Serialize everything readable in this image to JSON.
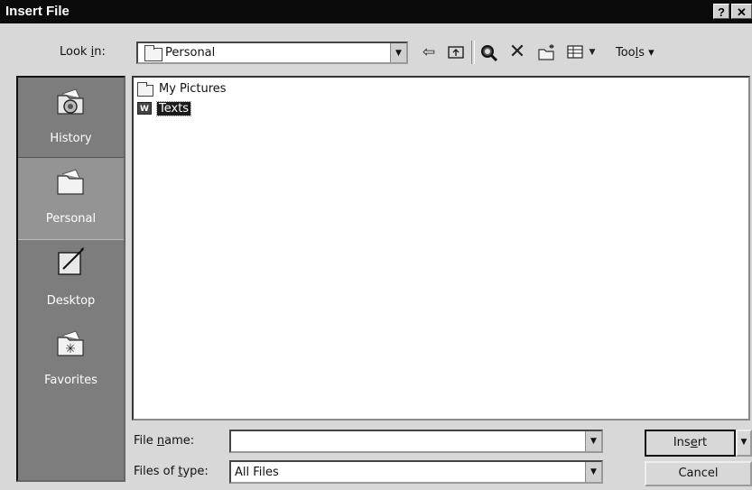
{
  "window": {
    "title": "Insert File",
    "help_label": "?",
    "close_label": "✕"
  },
  "lookin": {
    "label": "Look in:",
    "value": "Personal"
  },
  "toolbar": {
    "tools_label": "Tools ▾",
    "icons": [
      "back-icon",
      "up-folder-icon",
      "search-web-icon",
      "delete-icon",
      "new-folder-icon",
      "views-icon"
    ]
  },
  "places": [
    {
      "label": "History",
      "icon": "history-icon",
      "selected": false
    },
    {
      "label": "Personal",
      "icon": "personal-folder-icon",
      "selected": true
    },
    {
      "label": "Desktop",
      "icon": "desktop-icon",
      "selected": false
    },
    {
      "label": "Favorites",
      "icon": "favorites-icon",
      "selected": false
    }
  ],
  "files": [
    {
      "name": "My Pictures",
      "type": "folder",
      "selected": false
    },
    {
      "name": "Texts",
      "type": "word-document",
      "selected": true
    }
  ],
  "filename": {
    "label": "File name:",
    "value": ""
  },
  "filetype": {
    "label": "Files of type:",
    "value": "All Files"
  },
  "buttons": {
    "insert": "Insert",
    "cancel": "Cancel"
  }
}
